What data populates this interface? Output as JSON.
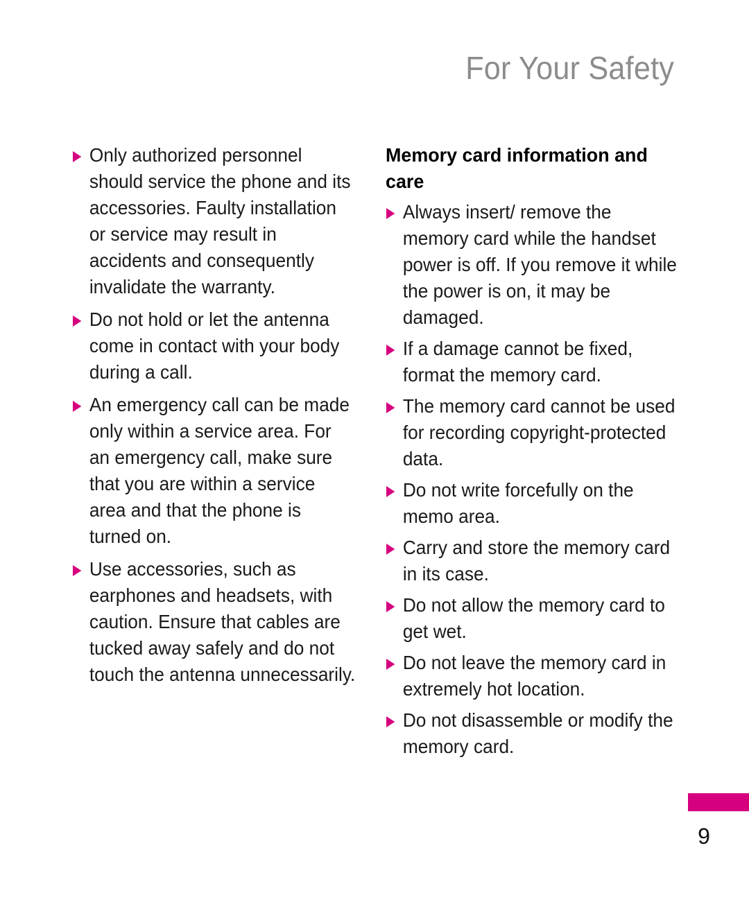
{
  "header": {
    "title": "For Your Safety"
  },
  "left_column": {
    "bullets": [
      "Only authorized personnel should service the phone and its accessories. Faulty installation or service may result in accidents and consequently invalidate the warranty.",
      "Do not hold or let the antenna come in contact with your body during a call.",
      "An emergency call can be made only within a service area. For an emergency call, make sure that you are within a service area and that the phone is turned on.",
      "Use accessories, such as earphones and headsets, with caution. Ensure that cables are tucked away safely and do not touch the antenna unnecessarily."
    ]
  },
  "right_column": {
    "heading": "Memory card information and care",
    "bullets": [
      "Always insert/ remove the memory card while the handset power is off. If you remove it while the power is on, it may be damaged.",
      "If a damage cannot be fixed, format the memory card.",
      "The memory card cannot be used for recording copyright-protected data.",
      "Do not write forcefully on the memo area.",
      "Carry and store the memory card in its case.",
      "Do not allow the memory card to get wet.",
      "Do not leave the memory card in extremely hot location.",
      "Do not disassemble or modify the memory card."
    ]
  },
  "footer": {
    "page_number": "9"
  },
  "colors": {
    "accent_magenta": "#d6007f",
    "header_gray": "#8c8c8c",
    "body_black": "#1a1a1a"
  }
}
